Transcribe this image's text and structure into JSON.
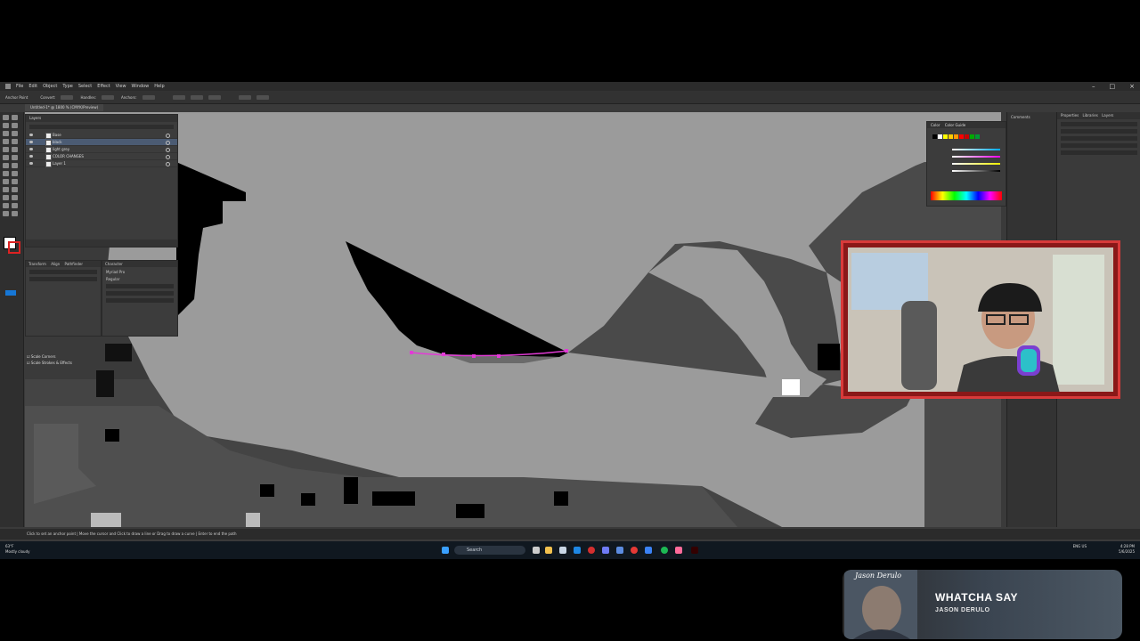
{
  "menu": {
    "items": [
      "File",
      "Edit",
      "Object",
      "Type",
      "Select",
      "Effect",
      "View",
      "Window",
      "Help"
    ]
  },
  "control_bar": {
    "tool_label": "Anchor Point",
    "convert_label": "Convert:",
    "handles_label": "Handles:",
    "anchors_label": "Anchors:"
  },
  "document_tab": {
    "title": "Untitled-1* @ 1800 % (CMYK/Preview)"
  },
  "layers_panel": {
    "tab_label": "Layers",
    "layers": [
      {
        "name": "Base",
        "selected": false
      },
      {
        "name": "black",
        "selected": true
      },
      {
        "name": "light grey",
        "selected": false
      },
      {
        "name": "COLOR CHANGES",
        "selected": false
      },
      {
        "name": "Layer 1",
        "selected": false
      }
    ]
  },
  "transform_panel": {
    "tabs": [
      "Transform",
      "Align",
      "Pathfinder"
    ]
  },
  "character_panel": {
    "tab_label": "Character",
    "font": "Myriad Pro",
    "style": "Regular"
  },
  "checkboxes": [
    {
      "label": "Scale Corners"
    },
    {
      "label": "Scale Strokes & Effects"
    }
  ],
  "color_panel": {
    "tabs": [
      "Color",
      "Color Guide"
    ],
    "swatches": [
      "#000000",
      "#ffffff",
      "#ffff00",
      "#ffcc00",
      "#ff9900",
      "#ff0000",
      "#cc0000",
      "#00aa00",
      "#009933"
    ]
  },
  "properties_panel": {
    "tabs": [
      "Properties",
      "Libraries",
      "Layers"
    ],
    "comments_label": "Comments"
  },
  "status_bar": {
    "text": "Click to set an anchor point | Move the cursor and Click to draw a line or Drag to draw a curve | Enter to end the path"
  },
  "taskbar": {
    "weather_temp": "63°F",
    "weather_desc": "Mostly cloudy",
    "search_label": "Search",
    "time": "4:28 PM",
    "date": "5/6/2025",
    "lang": "ENG US"
  },
  "now_playing": {
    "song_title": "WHATCHA SAY",
    "artist": "JASON DERULO",
    "art_text": "Jason Derulo"
  }
}
